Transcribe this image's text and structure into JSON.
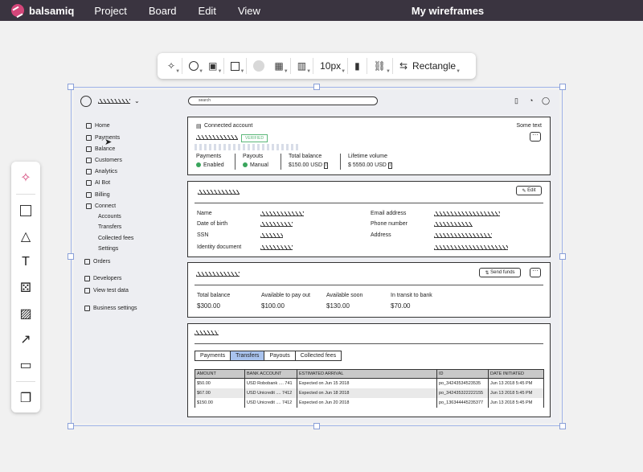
{
  "app": {
    "name": "balsamiq",
    "menu": [
      "Project",
      "Board",
      "Edit",
      "View"
    ],
    "document_title": "My wireframes"
  },
  "toolbar": {
    "font_size": "10px",
    "shape_label": "Rectangle"
  },
  "left_tools": [
    "ai-sparkle-icon",
    "rectangle-icon",
    "shapes-icon",
    "text-icon",
    "components-icon",
    "image-icon",
    "arrow-icon",
    "comment-icon",
    "copy-icon"
  ],
  "wireframe": {
    "search_placeholder": "search",
    "nav": [
      {
        "label": "Home",
        "icon": "home-icon"
      },
      {
        "label": "Payments",
        "icon": "card-icon"
      },
      {
        "label": "Balance",
        "icon": "swap-icon"
      },
      {
        "label": "Customers",
        "icon": "user-icon"
      },
      {
        "label": "Analytics",
        "icon": "chart-icon"
      },
      {
        "label": "AI Bot",
        "icon": "bot-icon"
      },
      {
        "label": "Billing",
        "icon": "billing-icon"
      },
      {
        "label": "Connect",
        "icon": "connect-icon"
      },
      {
        "label": "Accounts"
      },
      {
        "label": "Transfers"
      },
      {
        "label": "Collected fees"
      },
      {
        "label": "Settings"
      },
      {
        "label": "Orders",
        "icon": "cart-icon"
      },
      {
        "label": "Developers",
        "icon": "code-icon"
      },
      {
        "label": "View test data",
        "icon": "toggle-icon"
      },
      {
        "label": "Business settings",
        "icon": "settings-icon"
      }
    ],
    "account": {
      "label": "Connected account",
      "some_text": "Some text",
      "badge": "VERIFIED",
      "stats": [
        {
          "title": "Payments",
          "value": "Enabled",
          "check": true
        },
        {
          "title": "Payouts",
          "value": "Manual",
          "check": true
        },
        {
          "title": "Total balance",
          "value": "$150.00 USD",
          "info": true
        },
        {
          "title": "Lifetime volume",
          "value": "$ 5550.00 USD",
          "info": true
        }
      ]
    },
    "profile": {
      "edit_label": "Edit",
      "left_fields": [
        "Name",
        "Date of birth",
        "SSN",
        "Identity document"
      ],
      "right_fields": [
        "Email address",
        "Phone number",
        "Address"
      ]
    },
    "balances": {
      "send_label": "Send funds",
      "items": [
        {
          "title": "Total balance",
          "value": "$300.00"
        },
        {
          "title": "Available to pay out",
          "value": "$100.00"
        },
        {
          "title": "Available soon",
          "value": "$130.00"
        },
        {
          "title": "In transit to bank",
          "value": "$70.00"
        }
      ]
    },
    "transfers": {
      "tabs": [
        "Payments",
        "Transfers",
        "Payouts",
        "Collected fees"
      ],
      "active_tab": "Transfers",
      "columns": [
        "AMOUNT",
        "BANK ACCOUNT",
        "ESTIMATED ARRIVAL",
        "ID",
        "DATE INITIATED"
      ],
      "rows": [
        [
          "$50.00",
          "USD Robobank .... 741",
          "Expected on Jun 15 2018",
          "po_34243534523535",
          "Jun 13 2018 5:45 PM"
        ],
        [
          "$67.00",
          "USD Unicredit .... 7412",
          "Expected on Jun 18 2018",
          "po_342435322222155",
          "Jun 13 2018 5:45 PM"
        ],
        [
          "$150.00",
          "USD Unicredit .... 7412",
          "Expected on Jun 20 2018",
          "po_136344445235377",
          "Jun 13 2018 5:45 PM"
        ]
      ]
    }
  }
}
